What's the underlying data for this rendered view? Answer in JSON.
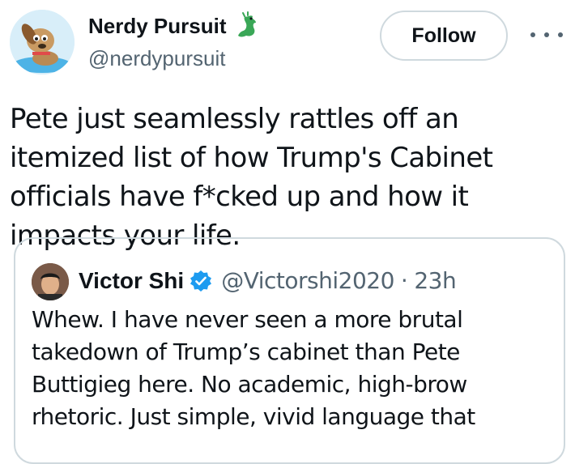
{
  "tweet": {
    "author": {
      "name": "Nerdy Pursuit",
      "handle": "@nerdypursuit",
      "avatar_icon": "cartoon-dog-avatar",
      "name_emoji": "dragon-icon"
    },
    "follow_label": "Follow",
    "more_icon": "more-horizontal-icon",
    "text": "Pete just seamlessly rattles off an itemized list of how Trump's Cabinet officials have f*cked up and how it impacts your life."
  },
  "quote": {
    "author": {
      "name": "Victor Shi",
      "handle": "@Victorshi2020",
      "verified_icon": "verified-badge-icon",
      "avatar_icon": "photo-avatar"
    },
    "separator": "·",
    "time": "23h",
    "text": "Whew. I have never seen a more brutal takedown of Trump’s cabinet than Pete Buttigieg here. No academic, high-brow rhetoric. Just simple, vivid language that"
  },
  "colors": {
    "text_primary": "#0f1419",
    "text_secondary": "#536471",
    "border": "#cfd9de",
    "verified": "#1d9bf0",
    "dragon": "#3aa757"
  }
}
